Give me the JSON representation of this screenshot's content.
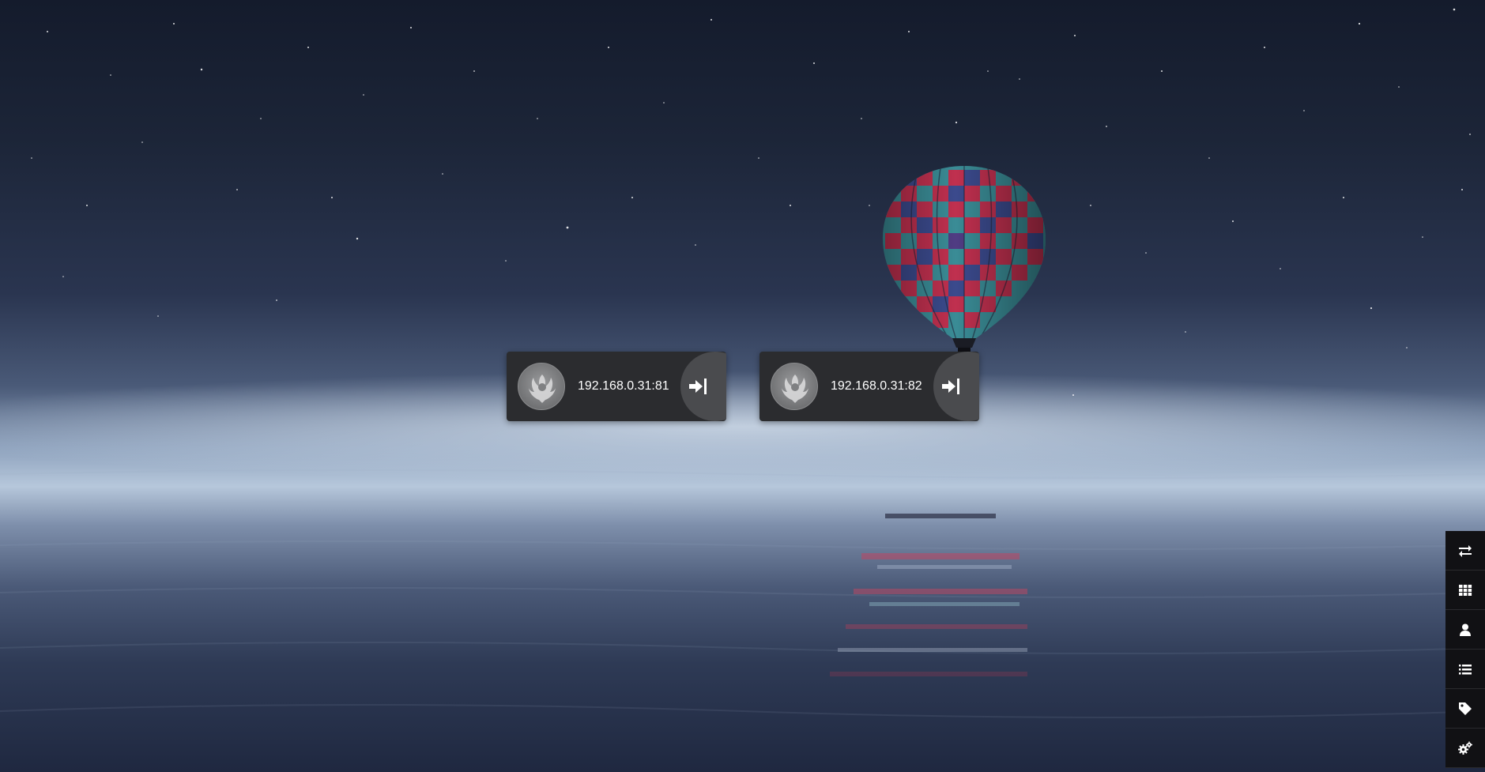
{
  "servers": [
    {
      "address": "192.168.0.31:81"
    },
    {
      "address": "192.168.0.31:82"
    }
  ],
  "toolbar": {
    "items": [
      {
        "icon": "swap-arrows-icon"
      },
      {
        "icon": "grid-icon"
      },
      {
        "icon": "user-icon"
      },
      {
        "icon": "list-icon"
      },
      {
        "icon": "tag-icon"
      },
      {
        "icon": "settings-cogs-icon"
      }
    ]
  },
  "colors": {
    "card_background": "#2b2c2f",
    "login_button": "#4a4b4e",
    "toolbar_background": "#111114",
    "text": "#ffffff"
  }
}
